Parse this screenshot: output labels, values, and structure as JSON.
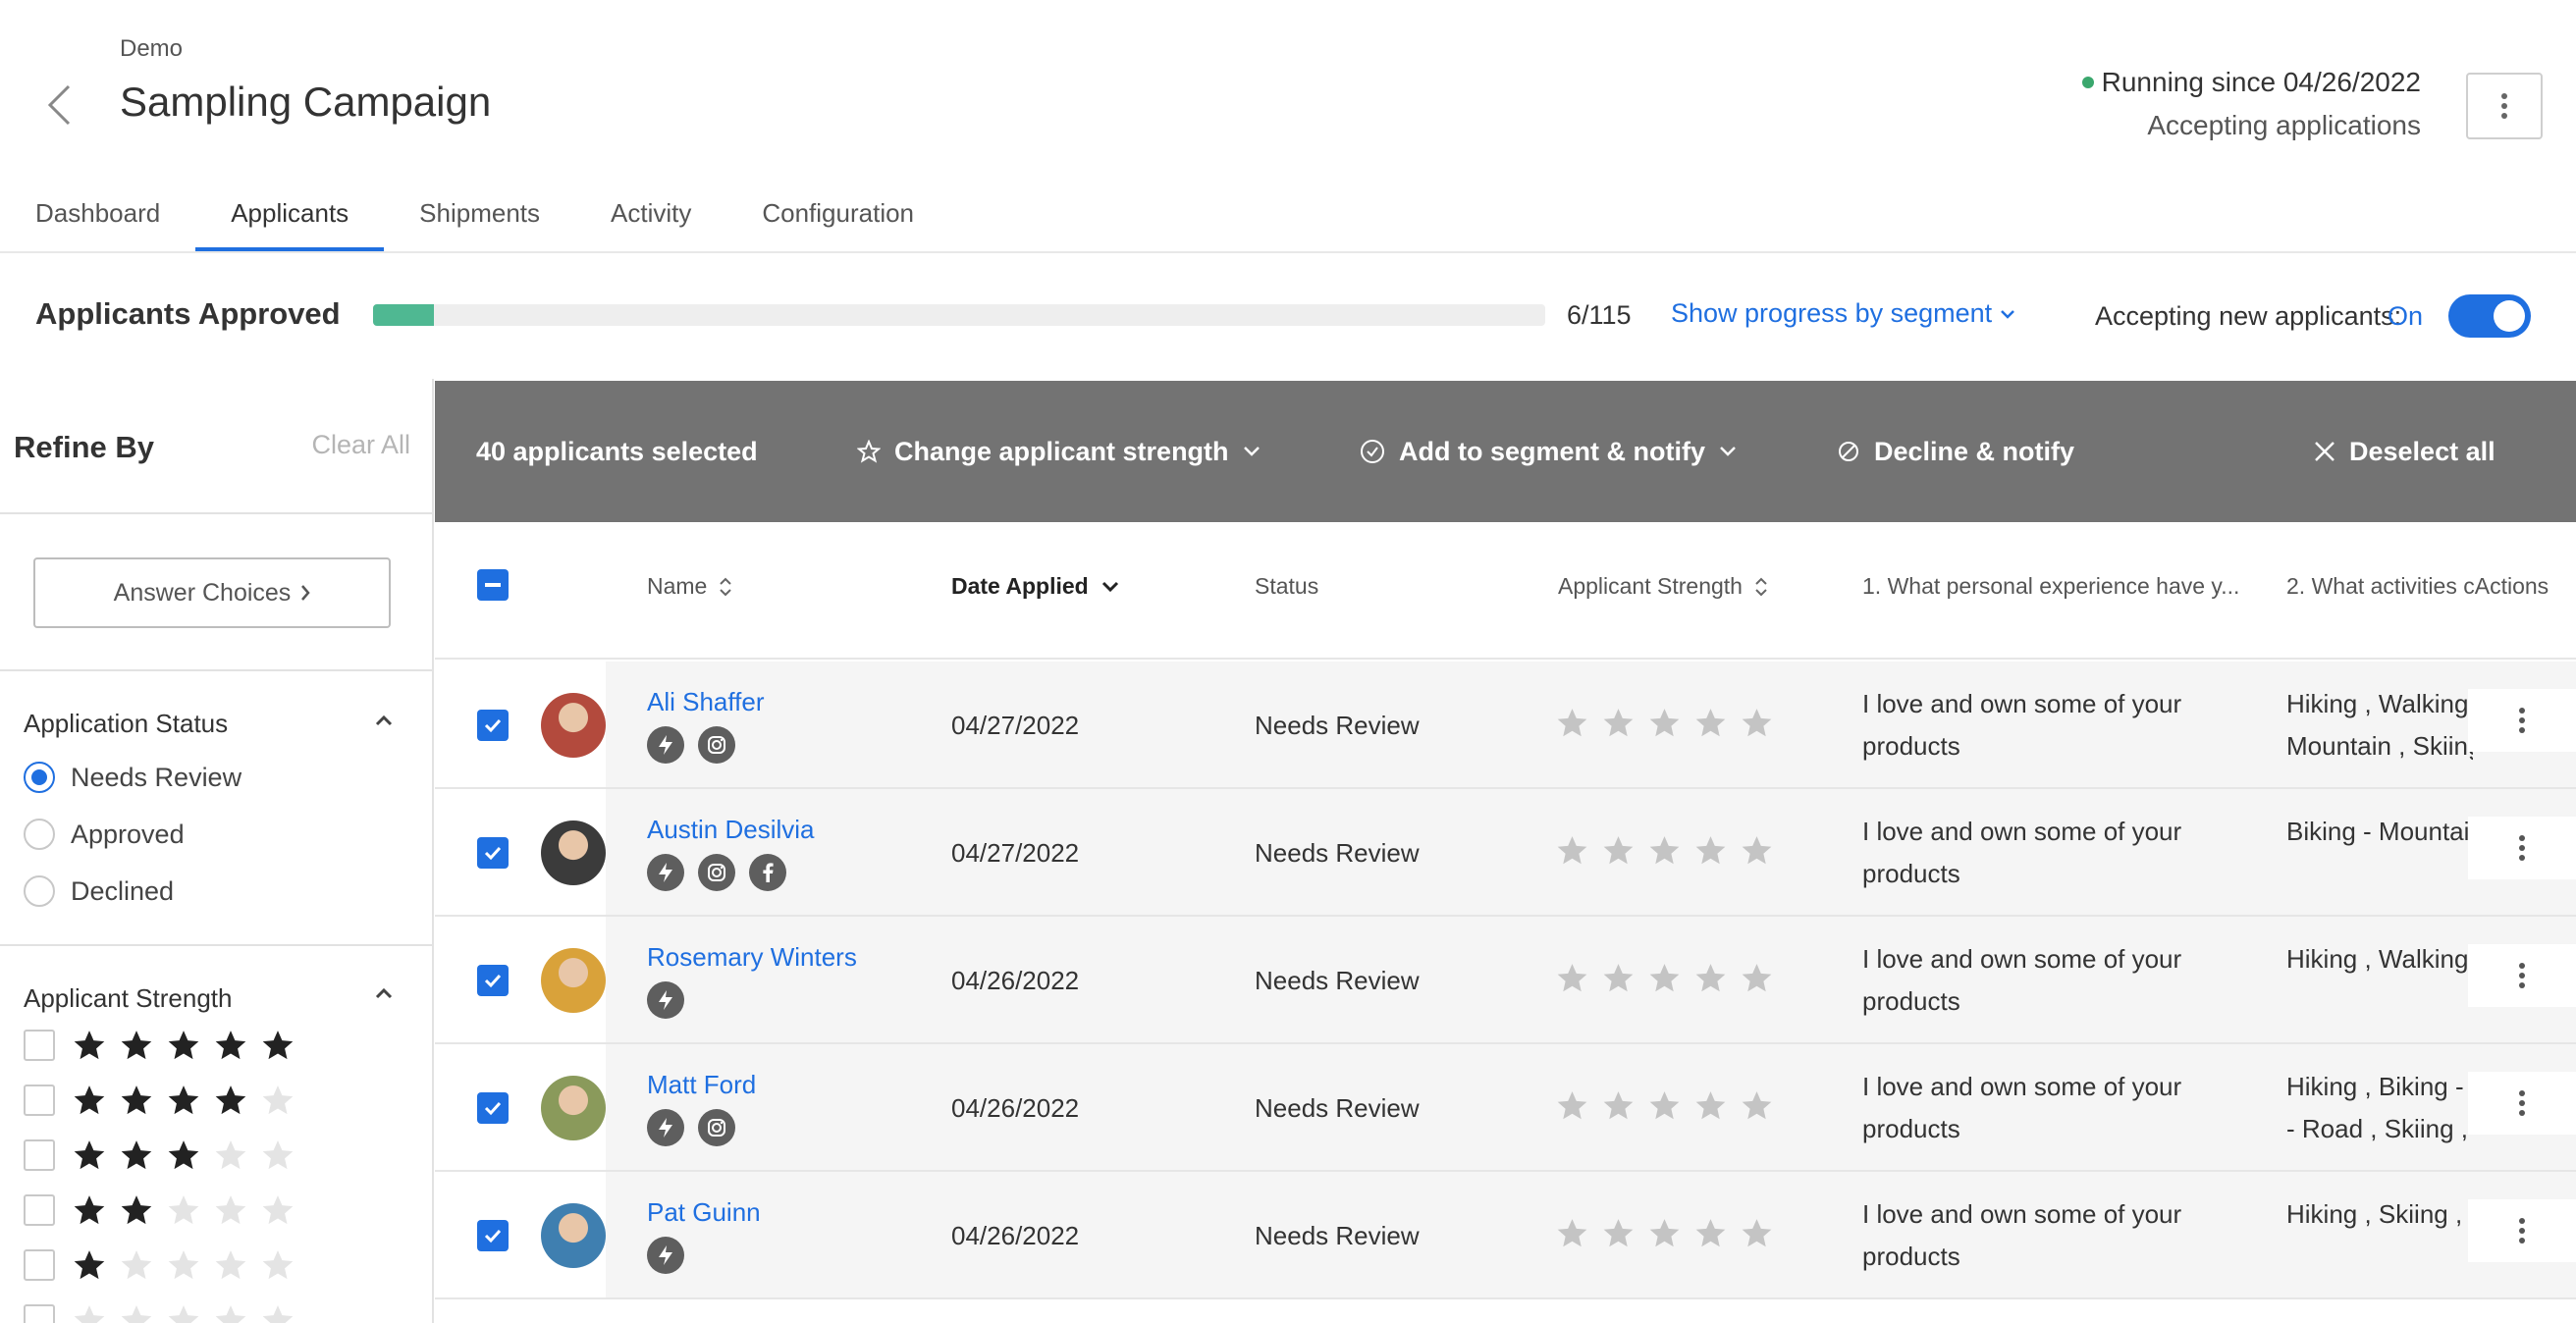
{
  "header": {
    "breadcrumb": "Demo",
    "title": "Sampling Campaign",
    "running_status": "Running since 04/26/2022",
    "accepting_status": "Accepting applications"
  },
  "tabs": [
    {
      "label": "Dashboard",
      "active": false
    },
    {
      "label": "Applicants",
      "active": true
    },
    {
      "label": "Shipments",
      "active": false
    },
    {
      "label": "Activity",
      "active": false
    },
    {
      "label": "Configuration",
      "active": false
    }
  ],
  "progress": {
    "label": "Applicants Approved",
    "approved": 6,
    "total": 115,
    "count_text": "6/115",
    "segment_link": "Show progress by segment",
    "accepting_label": "Accepting new applicants:",
    "accepting_state": "On"
  },
  "sidebar": {
    "title": "Refine By",
    "clear_all": "Clear All",
    "answer_choices": "Answer Choices",
    "status_heading": "Application Status",
    "status_options": [
      "Needs Review",
      "Approved",
      "Declined"
    ],
    "selected_status": "Needs Review",
    "strength_heading": "Applicant Strength",
    "strength_levels": [
      5,
      4,
      3,
      2,
      1
    ]
  },
  "bulk": {
    "selected_text": "40 applicants selected",
    "change_strength": "Change applicant strength",
    "add_segment": "Add to segment & notify",
    "decline": "Decline & notify",
    "deselect": "Deselect all"
  },
  "table": {
    "columns": {
      "name": "Name",
      "date": "Date Applied",
      "status": "Status",
      "strength": "Applicant Strength",
      "q1": "1. What personal experience have y...",
      "q2": "2. What activities c",
      "actions": "Actions"
    },
    "rows": [
      {
        "name": "Ali Shaffer",
        "date": "04/27/2022",
        "status": "Needs Review",
        "q1": "I love and own some of your products",
        "q2_line1": "Hiking , Walking",
        "q2_line2": "Mountain , Skiing",
        "socials": [
          "bolt",
          "instagram"
        ],
        "avatar_color": "#b34a3d"
      },
      {
        "name": "Austin Desilvia",
        "date": "04/27/2022",
        "status": "Needs Review",
        "q1": "I love and own some of your products",
        "q2_line1": "Biking - Mountai",
        "q2_line2": "",
        "socials": [
          "bolt",
          "instagram",
          "facebook"
        ],
        "avatar_color": "#3b3b3b"
      },
      {
        "name": "Rosemary Winters",
        "date": "04/26/2022",
        "status": "Needs Review",
        "q1": "I love and own some of your products",
        "q2_line1": "Hiking , Walking",
        "q2_line2": "",
        "socials": [
          "bolt"
        ],
        "avatar_color": "#d9a23a"
      },
      {
        "name": "Matt Ford",
        "date": "04/26/2022",
        "status": "Needs Review",
        "q1": "I love and own some of your products",
        "q2_line1": "Hiking , Biking - I",
        "q2_line2": "- Road , Skiing , Y",
        "socials": [
          "bolt",
          "instagram"
        ],
        "avatar_color": "#8a9a5b"
      },
      {
        "name": "Pat Guinn",
        "date": "04/26/2022",
        "status": "Needs Review",
        "q1": "I love and own some of your products",
        "q2_line1": "Hiking , Skiing , C",
        "q2_line2": "",
        "socials": [
          "bolt"
        ],
        "avatar_color": "#3f7fb0"
      }
    ]
  },
  "colors": {
    "accent": "#1f6fe0",
    "progress_fill": "#4fb892",
    "bulk_bar": "#737373",
    "running_dot": "#3aa76d"
  }
}
